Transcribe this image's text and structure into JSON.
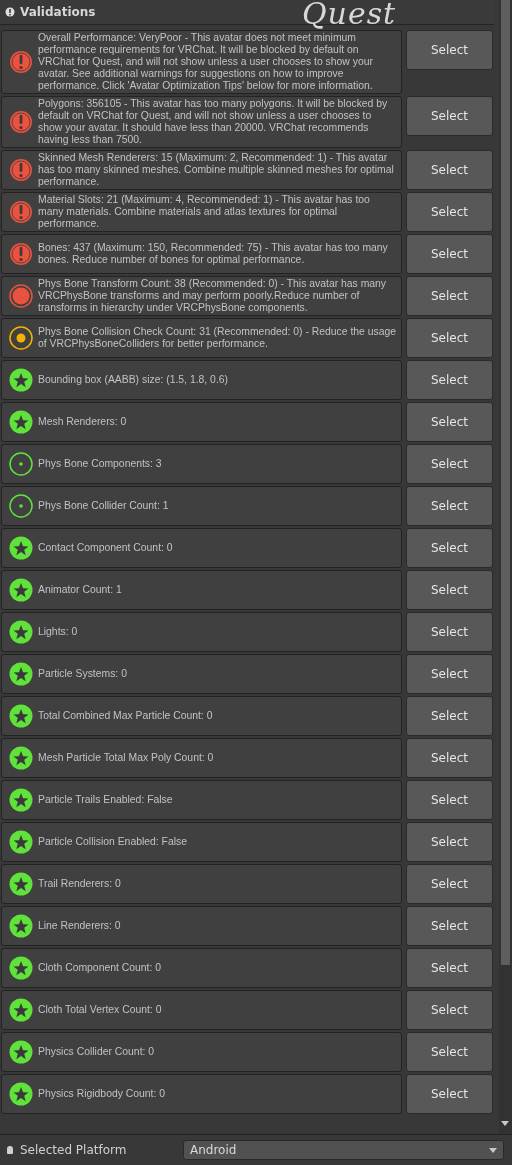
{
  "header": {
    "title": "Validations"
  },
  "annotation": {
    "text": "Quest"
  },
  "validations": [
    {
      "kind": "very_poor",
      "message": "Overall Performance: VeryPoor - This avatar does not meet minimum performance requirements for VRChat. It will be blocked by default on VRChat for Quest, and will not show unless a user chooses to show your avatar. See additional warnings for suggestions on how to improve performance. Click 'Avatar Optimization Tips' below for more information.",
      "button": "Select"
    },
    {
      "kind": "very_poor",
      "message": "Polygons: 356105 - This avatar has too many polygons. It will be blocked by default on VRChat for Quest, and will not show unless a user chooses to show your avatar. It should have less than 20000. VRChat recommends having less than 7500.",
      "button": "Select"
    },
    {
      "kind": "very_poor",
      "message": "Skinned Mesh Renderers: 15 (Maximum: 2, Recommended: 1) - This avatar has too many skinned meshes. Combine multiple skinned meshes for optimal performance.",
      "button": "Select"
    },
    {
      "kind": "very_poor",
      "message": "Material Slots: 21 (Maximum: 4, Recommended: 1) - This avatar has too many materials. Combine materials and atlas textures for optimal performance.",
      "button": "Select"
    },
    {
      "kind": "very_poor",
      "message": "Bones: 437 (Maximum: 150, Recommended: 75) - This avatar has too many bones. Reduce number of bones for optimal performance.",
      "button": "Select"
    },
    {
      "kind": "poor",
      "message": "Phys Bone Transform Count: 38 (Recommended: 0) - This avatar has many VRCPhysBone transforms and may perform poorly.Reduce number of transforms in hierarchy under VRCPhysBone components.",
      "button": "Select"
    },
    {
      "kind": "medium",
      "message": "Phys Bone Collision Check Count: 31 (Recommended: 0) - Reduce the usage of VRCPhysBoneColliders for better performance.",
      "button": "Select"
    },
    {
      "kind": "excellent",
      "message": "Bounding box (AABB) size: (1.5, 1.8, 0.6)",
      "button": "Select"
    },
    {
      "kind": "excellent",
      "message": "Mesh Renderers: 0",
      "button": "Select"
    },
    {
      "kind": "info",
      "message": "Phys Bone Components: 3",
      "button": "Select"
    },
    {
      "kind": "info",
      "message": "Phys Bone Collider Count: 1",
      "button": "Select"
    },
    {
      "kind": "excellent",
      "message": "Contact Component Count: 0",
      "button": "Select"
    },
    {
      "kind": "excellent",
      "message": "Animator Count: 1",
      "button": "Select"
    },
    {
      "kind": "excellent",
      "message": "Lights: 0",
      "button": "Select"
    },
    {
      "kind": "excellent",
      "message": "Particle Systems: 0",
      "button": "Select"
    },
    {
      "kind": "excellent",
      "message": "Total Combined Max Particle Count: 0",
      "button": "Select"
    },
    {
      "kind": "excellent",
      "message": "Mesh Particle Total Max Poly Count: 0",
      "button": "Select"
    },
    {
      "kind": "excellent",
      "message": "Particle Trails Enabled: False",
      "button": "Select"
    },
    {
      "kind": "excellent",
      "message": "Particle Collision Enabled: False",
      "button": "Select"
    },
    {
      "kind": "excellent",
      "message": "Trail Renderers: 0",
      "button": "Select"
    },
    {
      "kind": "excellent",
      "message": "Line Renderers: 0",
      "button": "Select"
    },
    {
      "kind": "excellent",
      "message": "Cloth Component Count: 0",
      "button": "Select"
    },
    {
      "kind": "excellent",
      "message": "Cloth Total Vertex Count: 0",
      "button": "Select"
    },
    {
      "kind": "excellent",
      "message": "Physics Collider Count: 0",
      "button": "Select"
    },
    {
      "kind": "excellent",
      "message": "Physics Rigidbody Count: 0",
      "button": "Select"
    }
  ],
  "platform": {
    "label": "Selected Platform",
    "value": "Android"
  }
}
